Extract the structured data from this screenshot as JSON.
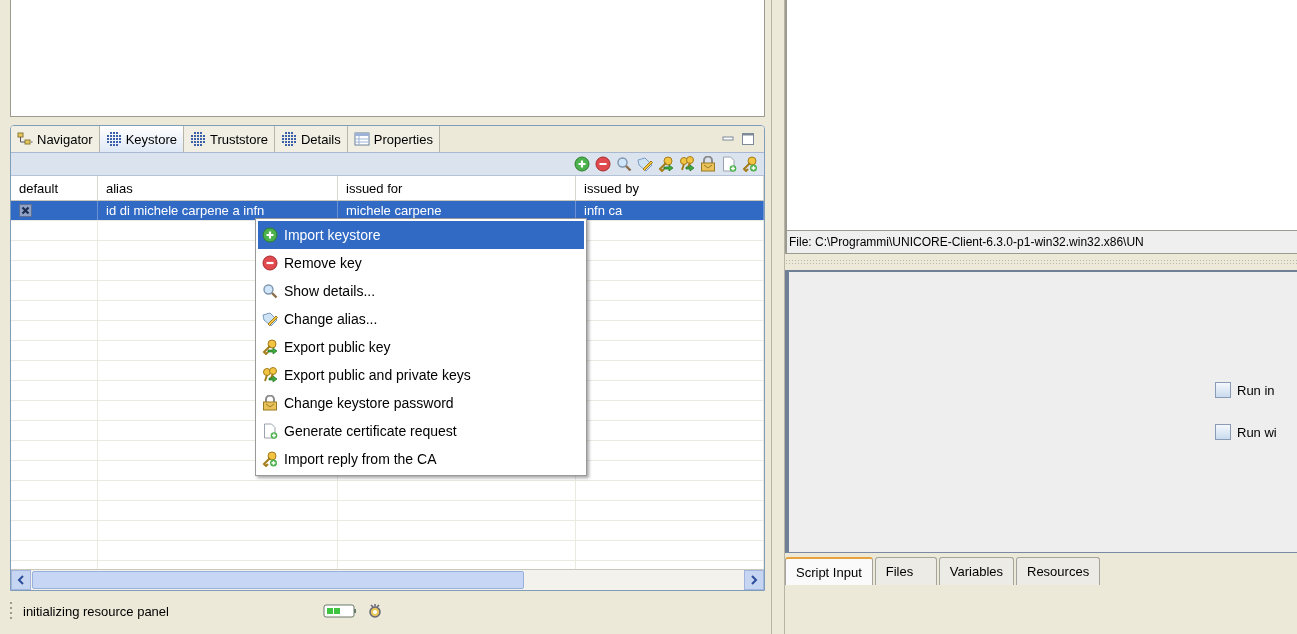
{
  "view_tabs": [
    {
      "label": "Navigator",
      "kind": "tree",
      "selected": false
    },
    {
      "label": "Keystore",
      "kind": "grid",
      "selected": true
    },
    {
      "label": "Truststore",
      "kind": "grid",
      "selected": false
    },
    {
      "label": "Details",
      "kind": "grid",
      "selected": false
    },
    {
      "label": "Properties",
      "kind": "table",
      "selected": false
    }
  ],
  "toolbar": [
    {
      "kind": "add"
    },
    {
      "kind": "remove"
    },
    {
      "kind": "details"
    },
    {
      "kind": "rename"
    },
    {
      "kind": "export_public"
    },
    {
      "kind": "export_all"
    },
    {
      "kind": "password"
    },
    {
      "kind": "request"
    },
    {
      "kind": "reply"
    }
  ],
  "table": {
    "columns": [
      "default",
      "alias",
      "issued for",
      "issued by"
    ],
    "rows": [
      {
        "default": true,
        "alias": "id di michele carpene a infn",
        "issued_for": "michele carpene",
        "issued_by": "infn ca",
        "selected": true
      }
    ]
  },
  "context_menu": {
    "items": [
      {
        "label": "Import keystore",
        "kind": "add",
        "selected": true
      },
      {
        "label": "Remove key",
        "kind": "remove",
        "selected": false
      },
      {
        "label": "Show details...",
        "kind": "details",
        "selected": false
      },
      {
        "label": "Change alias...",
        "kind": "rename",
        "selected": false
      },
      {
        "label": "Export public key",
        "kind": "export_public",
        "selected": false
      },
      {
        "label": "Export public and private keys",
        "kind": "export_all",
        "selected": false
      },
      {
        "label": "Change keystore password",
        "kind": "password",
        "selected": false
      },
      {
        "label": "Generate certificate request",
        "kind": "request",
        "selected": false
      },
      {
        "label": "Import reply from the CA",
        "kind": "reply",
        "selected": false
      }
    ]
  },
  "status_bar": {
    "text": "initializing resource panel"
  },
  "file_label": "File: C:\\Programmi\\UNICORE-Client-6.3.0-p1-win32.win32.x86\\UN",
  "options": [
    {
      "label": "Run in",
      "checked": false
    },
    {
      "label": "Run wi",
      "checked": false
    }
  ],
  "editor_tabs": [
    {
      "label": "Script Input",
      "selected": true
    },
    {
      "label": "Files",
      "selected": false
    },
    {
      "label": "Variables",
      "selected": false
    },
    {
      "label": "Resources",
      "selected": false
    }
  ]
}
